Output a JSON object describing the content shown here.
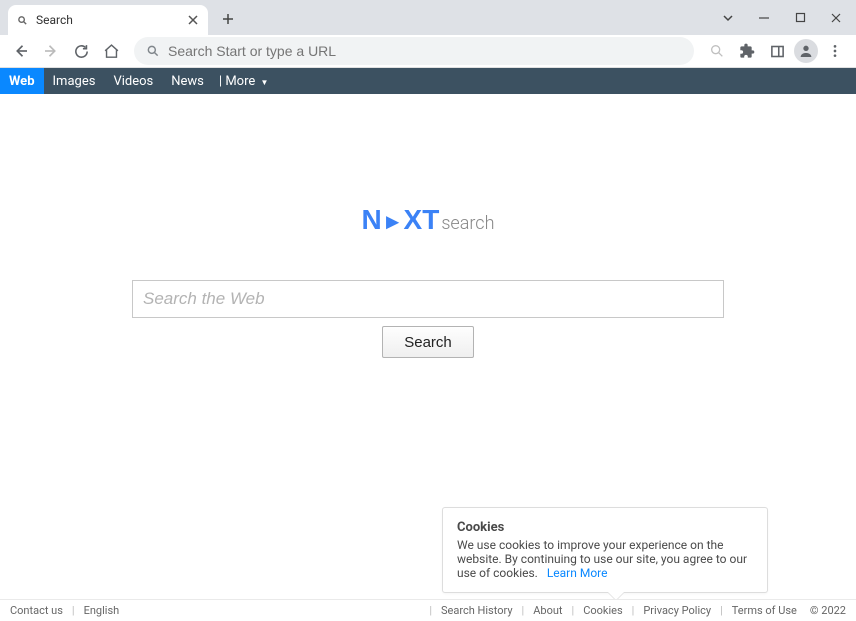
{
  "browser": {
    "tab_title": "Search",
    "omnibox_placeholder": "Search Start or type a URL"
  },
  "se_nav": {
    "web": "Web",
    "images": "Images",
    "videos": "Videos",
    "news": "News",
    "more_prefix": "|",
    "more": "More"
  },
  "logo": {
    "part1": "N",
    "part2": "XT",
    "sub": "search"
  },
  "main": {
    "search_placeholder": "Search the Web",
    "search_button": "Search"
  },
  "cookie": {
    "title": "Cookies",
    "text": "We use cookies to improve your experience on the website. By continuing to use our site, you agree to our use of cookies.",
    "learn_more": "Learn More"
  },
  "footer": {
    "left": {
      "contact": "Contact us",
      "language": "English"
    },
    "right": {
      "history": "Search History",
      "about": "About",
      "cookies": "Cookies",
      "privacy": "Privacy Policy",
      "terms": "Terms of Use",
      "copyright": "© 2022"
    }
  }
}
